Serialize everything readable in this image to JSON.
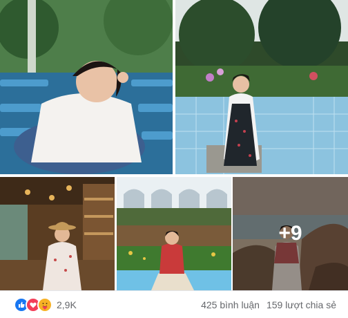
{
  "more_photos": "+9",
  "reactions": {
    "icons": [
      "like-icon",
      "love-icon",
      "care-icon"
    ],
    "count": "2,9K"
  },
  "comments": "425 bình luận",
  "shares": "159 lượt chia sẻ",
  "colors": {
    "like": "#1877f2",
    "love": "#f33e58",
    "care": "#f7b125",
    "text_secondary": "#65676b"
  }
}
